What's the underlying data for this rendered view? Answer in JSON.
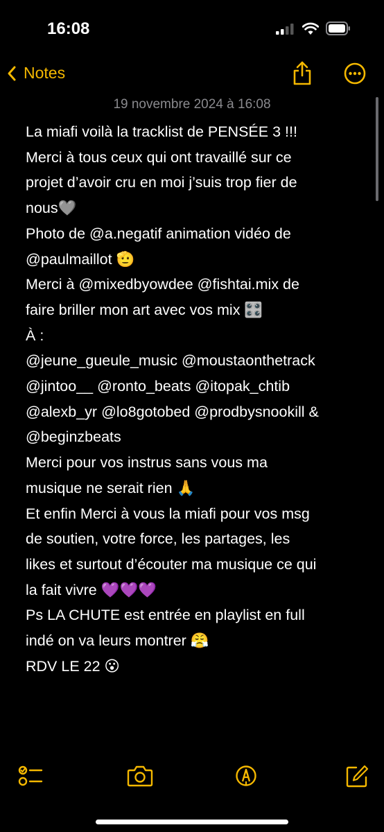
{
  "status_bar": {
    "time": "16:08"
  },
  "nav": {
    "back_label": "Notes",
    "share_icon": "share-icon",
    "more_icon": "ellipsis-circle-icon"
  },
  "note": {
    "date": "19 novembre 2024 à 16:08",
    "lines": [
      "La miafi voilà la tracklist de PENSÉE 3 !!!",
      "Merci à tous ceux qui ont travaillé sur ce",
      "projet d’avoir cru en moi j’suis trop fier de",
      "nous🩶",
      "Photo de @a.negatif animation vidéo de",
      "@paulmaillot  🫡",
      "Merci à @mixedbyowdee @fishtai.mix de",
      "faire briller mon art avec vos mix 🎛️",
      "À :",
      "@jeune_gueule_music @moustaonthetrack",
      "@jintoo__ @ronto_beats @itopak_chtib",
      "@alexb_yr @lo8gotobed @prodbysnookill &",
      "@beginzbeats",
      "Merci pour vos instrus sans vous ma",
      "musique ne serait rien 🙏",
      "Et enfin Merci à vous la miafi pour vos msg",
      "de soutien, votre force,  les partages, les",
      "likes et surtout d’écouter ma musique ce qui",
      "la fait vivre 💜💜💜",
      "Ps LA CHUTE est entrée en playlist en full",
      "indé on va leurs montrer 😤",
      "RDV LE 22 😮"
    ]
  },
  "toolbar": {
    "icons": [
      "checklist-icon",
      "camera-icon",
      "markup-icon",
      "compose-icon"
    ]
  },
  "colors": {
    "accent": "#f5b800",
    "background": "#000000",
    "text": "#ffffff",
    "secondary_text": "#8a8a8e"
  }
}
